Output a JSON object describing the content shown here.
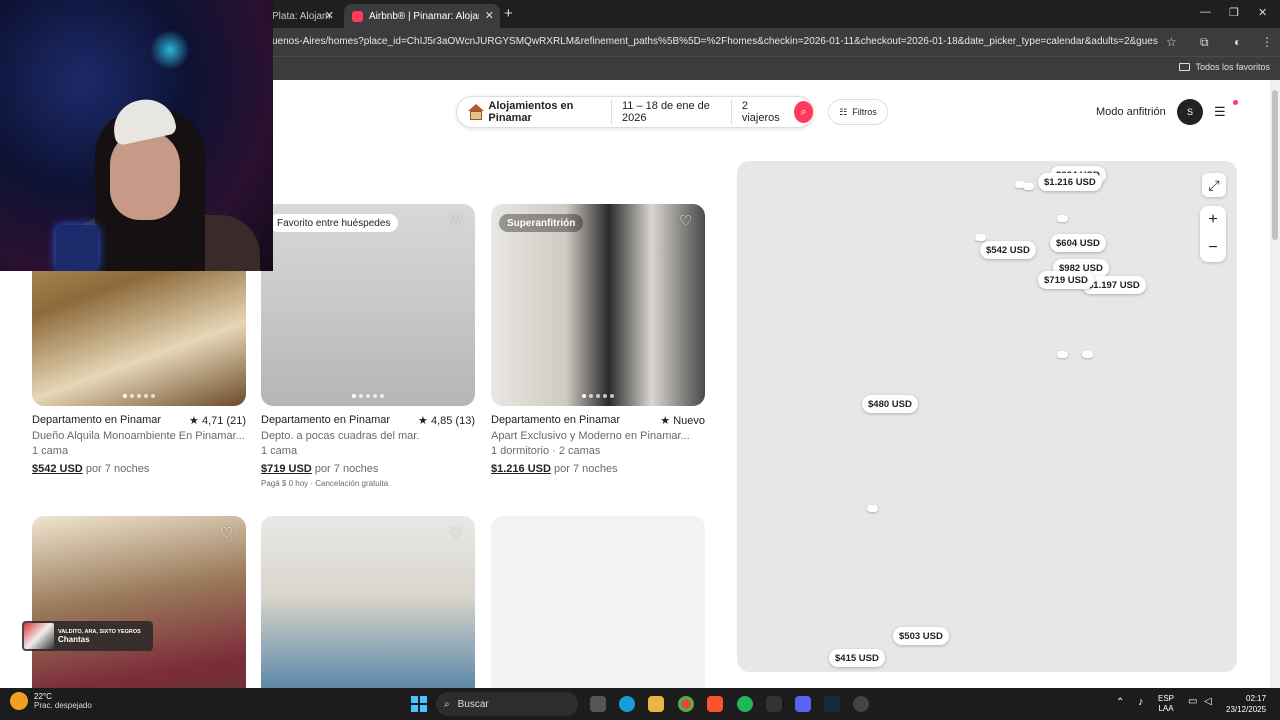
{
  "browser": {
    "tabs": [
      {
        "label": "Plata: Alojam",
        "active": false
      },
      {
        "label": "Airbnb® | Pinamar: Alojamient",
        "active": true
      }
    ],
    "url": "uenos-Aires/homes?place_id=ChIJ5r3aOWcnJURGYSMQwRXRLM&refinement_paths%5B%5D=%2Fhomes&checkin=2026-01-11&checkout=2026-01-18&date_picker_type=calendar&adults=2&guests=2&search_t...",
    "bookmarks_label": "Todos los favoritos"
  },
  "header": {
    "location": "Alojamientos en Pinamar",
    "dates": "11 – 18 de ene de 2026",
    "guests": "2 viajeros",
    "filters": "Filtros",
    "host_mode": "Modo anfitrión",
    "avatar_initial": "S"
  },
  "listings": [
    {
      "badge": "",
      "title": "Departamento en Pinamar",
      "rating": "★ 4,71 (21)",
      "subtitle": "Dueño Alquila Monoambiente En Pinamar...",
      "detail": "1 cama",
      "price": "$542 USD",
      "price_suffix": " por 7 noches",
      "note": ""
    },
    {
      "badge": "Favorito entre huéspedes",
      "title": "Departamento en Pinamar",
      "rating": "★ 4,85 (13)",
      "subtitle": "Depto. a pocas cuadras del mar.",
      "detail": "1 cama",
      "price": "$719 USD",
      "price_suffix": " por 7 noches",
      "note": "Pagá $ 0 hoy · Cancelación gratuita"
    },
    {
      "badge": "Superanfitrión",
      "title": "Departamento en Pinamar",
      "rating": "★ Nuevo",
      "subtitle": "Apart Exclusivo y Moderno en Pinamar...",
      "detail": "1 dormitorio · 2 camas",
      "price": "$1.216 USD",
      "price_suffix": " por 7 noches",
      "note": ""
    }
  ],
  "map": {
    "pins": [
      "$624 USD",
      "$1.216 USD",
      "$542 USD",
      "$604 USD",
      "$982 USD",
      "$719 USD",
      "$1.197 USD",
      "$480 USD",
      "$503 USD",
      "$415 USD"
    ],
    "zoom_in": "+",
    "zoom_out": "−"
  },
  "overlay": {
    "now_playing_artist": "VALDITO, ARA, SIXTO YEGROS",
    "now_playing_song": "Chantas"
  },
  "taskbar": {
    "temperature": "22°C",
    "weather": "Prac. despejado",
    "search": "Buscar",
    "lang": "ESP",
    "lang2": "LAA",
    "time": "02:17",
    "date": "23/12/2025"
  }
}
